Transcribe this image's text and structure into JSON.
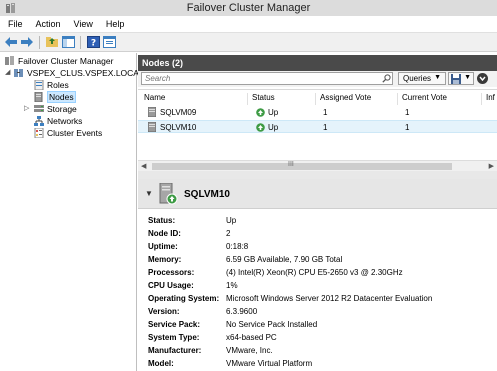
{
  "window": {
    "title": "Failover Cluster Manager"
  },
  "menu": [
    "File",
    "Action",
    "View",
    "Help"
  ],
  "tree": {
    "root": "Failover Cluster Manager",
    "cluster": "VSPEX_CLUS.VSPEX.LOCAL",
    "items": [
      "Roles",
      "Nodes",
      "Storage",
      "Networks",
      "Cluster Events"
    ]
  },
  "nodes_panel": {
    "header": "Nodes (2)",
    "search_placeholder": "Search",
    "queries_label": "Queries",
    "columns": [
      "Name",
      "Status",
      "Assigned Vote",
      "Current Vote",
      "Inf"
    ],
    "rows": [
      {
        "name": "SQLVM09",
        "status": "Up",
        "assigned_vote": "1",
        "current_vote": "1"
      },
      {
        "name": "SQLVM10",
        "status": "Up",
        "assigned_vote": "1",
        "current_vote": "1"
      }
    ],
    "scroll_grip": "III"
  },
  "details": {
    "title": "SQLVM10",
    "properties": [
      {
        "key": "Status:",
        "value": "Up"
      },
      {
        "key": "Node ID:",
        "value": "2"
      },
      {
        "key": "Uptime:",
        "value": "0:18:8"
      },
      {
        "key": "Memory:",
        "value": "6.59 GB Available, 7.90 GB Total"
      },
      {
        "key": "Processors:",
        "value": "(4) Intel(R) Xeon(R) CPU E5-2650 v3 @ 2.30GHz"
      },
      {
        "key": "CPU Usage:",
        "value": "1%"
      },
      {
        "key": "Operating System:",
        "value": "Microsoft Windows Server 2012 R2 Datacenter Evaluation"
      },
      {
        "key": "Version:",
        "value": "6.3.9600"
      },
      {
        "key": "Service Pack:",
        "value": "No Service Pack Installed"
      },
      {
        "key": "System Type:",
        "value": "x64-based PC"
      },
      {
        "key": "Manufacturer:",
        "value": "VMware, Inc."
      },
      {
        "key": "Model:",
        "value": "VMware Virtual Platform"
      }
    ]
  },
  "colors": {
    "accent": "#3c7fc0",
    "status_up": "#3e9b45",
    "header_dark": "#4a4a4a"
  }
}
